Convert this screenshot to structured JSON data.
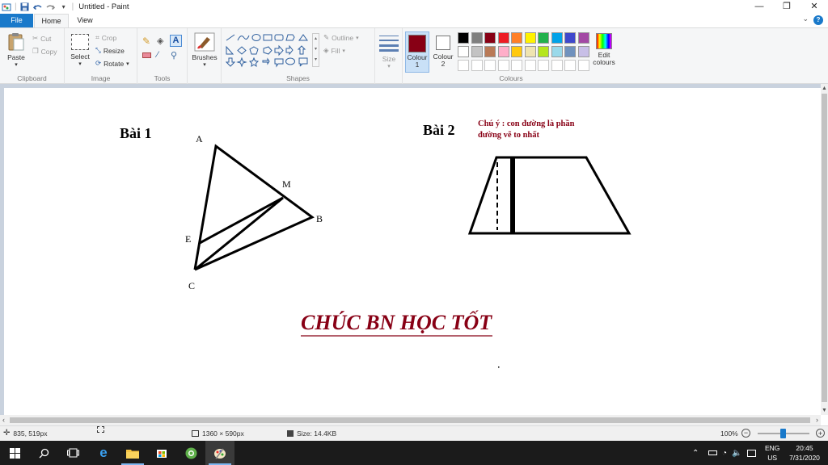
{
  "window": {
    "title": "Untitled - Paint",
    "minimize_icon": "minimize-icon",
    "restore_icon": "restore-icon",
    "close_icon": "close-icon"
  },
  "tabs": {
    "file": "File",
    "home": "Home",
    "view": "View"
  },
  "ribbon": {
    "clipboard": {
      "label": "Clipboard",
      "paste": "Paste",
      "cut": "Cut",
      "copy": "Copy"
    },
    "image": {
      "label": "Image",
      "select": "Select",
      "crop": "Crop",
      "resize": "Resize",
      "rotate": "Rotate"
    },
    "tools": {
      "label": "Tools"
    },
    "brushes": {
      "label": "Brushes"
    },
    "shapes": {
      "label": "Shapes",
      "outline": "Outline",
      "fill": "Fill"
    },
    "size": {
      "label": "Size"
    },
    "colours": {
      "label": "Colours",
      "colour1": "Colour 1",
      "colour2": "Colour 2",
      "edit": "Edit colours",
      "colour1_value": "#880015",
      "colour2_value": "#ffffff",
      "palette_row1": [
        "#000000",
        "#7f7f7f",
        "#880015",
        "#ed1c24",
        "#ff7f27",
        "#fff200",
        "#22b14c",
        "#00a2e8",
        "#3f48cc",
        "#a349a4"
      ],
      "palette_row2": [
        "#ffffff",
        "#c3c3c3",
        "#b97a57",
        "#ffaec9",
        "#ffc90e",
        "#efe4b0",
        "#b5e61d",
        "#99d9ea",
        "#7092be",
        "#c8bfe7"
      ]
    }
  },
  "drawing": {
    "bai1": "Bài 1",
    "bai2": "Bài 2",
    "label_a": "A",
    "label_m": "M",
    "label_b": "B",
    "label_e": "E",
    "label_c": "C",
    "note_line1": "Chú ý : con đường là phần",
    "note_line2": "đường vẽ to nhất",
    "closing": "CHÚC BN HỌC TỐT",
    "accent_color": "#880015"
  },
  "status": {
    "cursor": "835, 519px",
    "canvas_size": "1360 × 590px",
    "file_size": "Size: 14.4KB",
    "zoom": "100%"
  },
  "taskbar": {
    "lang1": "ENG",
    "lang2": "US",
    "time": "20:45",
    "date": "7/31/2020"
  }
}
